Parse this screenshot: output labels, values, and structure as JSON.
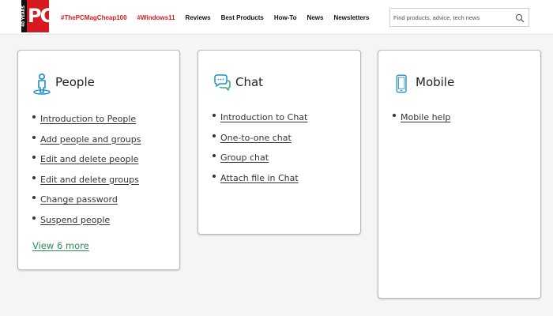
{
  "header": {
    "logo_badge": "40 YEARS",
    "logo_text": "PC",
    "nav": [
      {
        "label": "#ThePCMagCheap100",
        "hash": true
      },
      {
        "label": "#Windows11",
        "hash": true
      },
      {
        "label": "Reviews",
        "hash": false
      },
      {
        "label": "Best Products",
        "hash": false
      },
      {
        "label": "How-To",
        "hash": false
      },
      {
        "label": "News",
        "hash": false
      },
      {
        "label": "Newsletters",
        "hash": false
      }
    ],
    "search_placeholder": "Find products, advice, tech news"
  },
  "cards": {
    "people": {
      "title": "People",
      "icon": "person-icon",
      "links": [
        "Introduction to People",
        "Add people and groups",
        "Edit and delete people",
        "Edit and delete groups",
        "Change password",
        "Suspend people"
      ],
      "view_more": "View 6 more"
    },
    "chat": {
      "title": "Chat",
      "icon": "chat-bubbles-icon",
      "links": [
        "Introduction to Chat",
        "One-to-one chat",
        "Group chat",
        "Attach file in Chat"
      ]
    },
    "mobile": {
      "title": "Mobile",
      "icon": "mobile-phone-icon",
      "links": [
        "Mobile help"
      ]
    }
  },
  "colors": {
    "brand_red": "#d71920",
    "icon_blue": "#1a8fc9",
    "link_green": "#2e8b57"
  }
}
